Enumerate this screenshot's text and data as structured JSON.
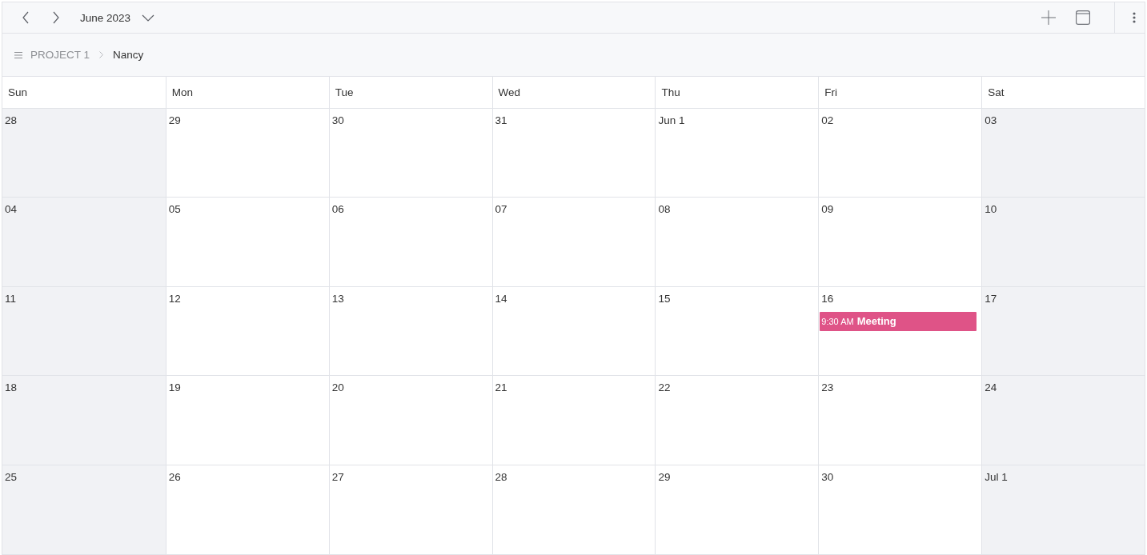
{
  "toolbar": {
    "title": "June 2023"
  },
  "breadcrumb": [
    {
      "label": "PROJECT 1",
      "selected": false
    },
    {
      "label": "Nancy",
      "selected": true
    }
  ],
  "calendar": {
    "days": [
      "Sun",
      "Mon",
      "Tue",
      "Wed",
      "Thu",
      "Fri",
      "Sat"
    ],
    "weeks": [
      {
        "days": [
          {
            "date": "28",
            "weekend": true
          },
          {
            "date": "29",
            "weekend": false
          },
          {
            "date": "30",
            "weekend": false
          },
          {
            "date": "31",
            "weekend": false
          },
          {
            "date": "Jun 1",
            "weekend": false
          },
          {
            "date": "02",
            "weekend": false
          },
          {
            "date": "03",
            "weekend": true
          }
        ]
      },
      {
        "days": [
          {
            "date": "04",
            "weekend": true
          },
          {
            "date": "05",
            "weekend": false
          },
          {
            "date": "06",
            "weekend": false
          },
          {
            "date": "07",
            "weekend": false
          },
          {
            "date": "08",
            "weekend": false
          },
          {
            "date": "09",
            "weekend": false
          },
          {
            "date": "10",
            "weekend": true
          }
        ]
      },
      {
        "days": [
          {
            "date": "11",
            "weekend": true
          },
          {
            "date": "12",
            "weekend": false
          },
          {
            "date": "13",
            "weekend": false
          },
          {
            "date": "14",
            "weekend": false
          },
          {
            "date": "15",
            "weekend": false
          },
          {
            "date": "16",
            "weekend": false,
            "events": [
              {
                "time": "9:30 AM",
                "title": "Meeting",
                "color": "#df5387"
              }
            ]
          },
          {
            "date": "17",
            "weekend": true
          }
        ]
      },
      {
        "days": [
          {
            "date": "18",
            "weekend": true
          },
          {
            "date": "19",
            "weekend": false
          },
          {
            "date": "20",
            "weekend": false
          },
          {
            "date": "21",
            "weekend": false
          },
          {
            "date": "22",
            "weekend": false
          },
          {
            "date": "23",
            "weekend": false
          },
          {
            "date": "24",
            "weekend": true
          }
        ]
      },
      {
        "days": [
          {
            "date": "25",
            "weekend": true
          },
          {
            "date": "26",
            "weekend": false
          },
          {
            "date": "27",
            "weekend": false
          },
          {
            "date": "28",
            "weekend": false
          },
          {
            "date": "29",
            "weekend": false
          },
          {
            "date": "30",
            "weekend": false
          },
          {
            "date": "Jul 1",
            "weekend": true
          }
        ]
      }
    ]
  }
}
